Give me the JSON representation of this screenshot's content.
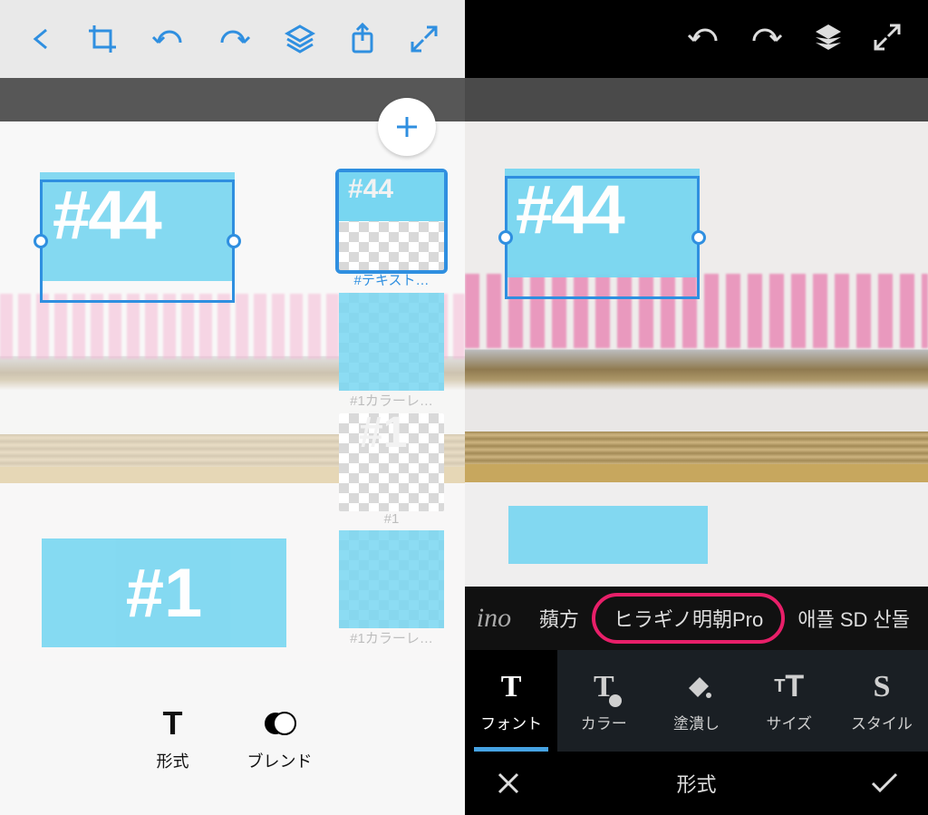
{
  "left": {
    "toolbar": [
      "back",
      "crop",
      "undo",
      "redo",
      "layers",
      "share",
      "fullscreen"
    ],
    "text_objects": {
      "primary": "#44",
      "secondary": "#1"
    },
    "layers": [
      {
        "label": "#テキスト…",
        "selected": true,
        "kind": "text44"
      },
      {
        "label": "#1カラーレ…",
        "selected": false,
        "kind": "solid"
      },
      {
        "label": "#1",
        "selected": false,
        "kind": "text1"
      },
      {
        "label": "#1カラーレ…",
        "selected": false,
        "kind": "solid"
      }
    ],
    "bottom_tabs": {
      "format": "形式",
      "blend": "ブレンド"
    }
  },
  "right": {
    "toolbar": [
      "undo",
      "redo",
      "layers",
      "fullscreen"
    ],
    "text_objects": {
      "primary": "#44"
    },
    "font_row": {
      "preview_glyph": "ino",
      "options": [
        {
          "label": "蘋方",
          "selected": false
        },
        {
          "label": "ヒラギノ明朝Pro",
          "selected": true
        },
        {
          "label": "애플 SD 산돌",
          "selected": false
        }
      ]
    },
    "format_tabs": [
      {
        "label": "フォント",
        "icon": "T",
        "active": true
      },
      {
        "label": "カラー",
        "icon": "palette",
        "active": false
      },
      {
        "label": "塗潰し",
        "icon": "bucket",
        "active": false
      },
      {
        "label": "サイズ",
        "icon": "size",
        "active": false
      },
      {
        "label": "スタイル",
        "icon": "S",
        "active": false
      }
    ],
    "footer_title": "形式"
  }
}
